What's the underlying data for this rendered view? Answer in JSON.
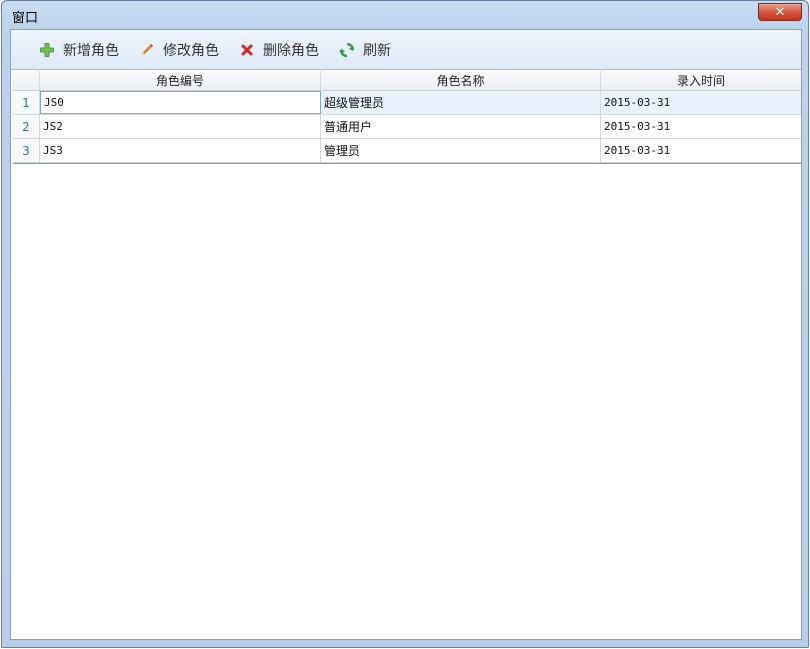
{
  "window": {
    "title": "窗口",
    "close_label": "✕"
  },
  "toolbar": {
    "buttons": [
      {
        "label": "新增角色",
        "icon": "add-icon"
      },
      {
        "label": "修改角色",
        "icon": "pencil-icon"
      },
      {
        "label": "删除角色",
        "icon": "delete-icon"
      },
      {
        "label": "刷新",
        "icon": "refresh-icon"
      }
    ]
  },
  "table": {
    "columns": [
      "角色编号",
      "角色名称",
      "录入时间"
    ],
    "rows": [
      {
        "num": "1",
        "code": "JS0",
        "name": "超级管理员",
        "time": "2015-03-31"
      },
      {
        "num": "2",
        "code": "JS2",
        "name": "普通用户",
        "time": "2015-03-31"
      },
      {
        "num": "3",
        "code": "JS3",
        "name": "管理员",
        "time": "2015-03-31"
      }
    ]
  },
  "colors": {
    "accent": "#3a6fb0",
    "add_green": "#4a9a3a",
    "delete_red": "#d42a1e",
    "refresh_green": "#3b9a4b",
    "pencil_orange": "#d9892b"
  }
}
